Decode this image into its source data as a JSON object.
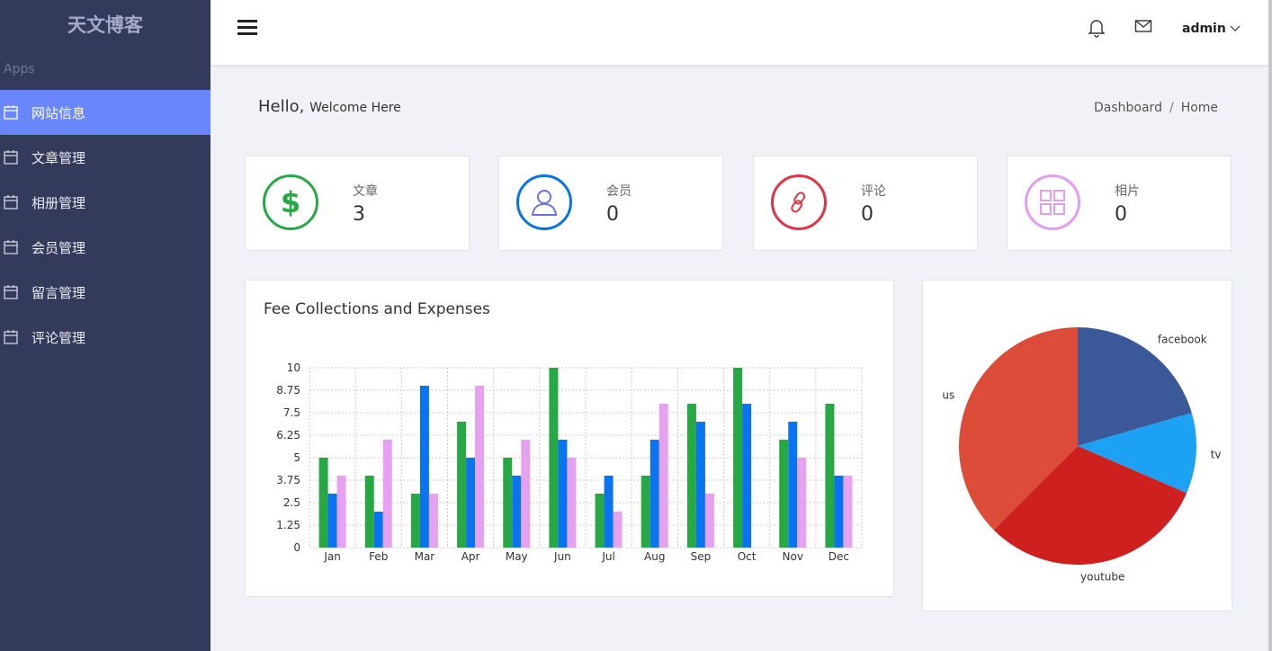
{
  "brand": "天文博客",
  "sidebar": {
    "section_label": "Apps",
    "items": [
      {
        "label": "网站信息",
        "active": true
      },
      {
        "label": "文章管理"
      },
      {
        "label": "相册管理"
      },
      {
        "label": "会员管理"
      },
      {
        "label": "留言管理"
      },
      {
        "label": "评论管理"
      }
    ]
  },
  "header": {
    "user": "admin"
  },
  "page": {
    "hello": "Hello,",
    "welcome": "Welcome Here",
    "breadcrumb": [
      "Dashboard",
      "Home"
    ]
  },
  "stats": [
    {
      "label": "文章",
      "value": "3",
      "icon": "dollar-icon",
      "color": "#28a745"
    },
    {
      "label": "会员",
      "value": "0",
      "icon": "user-icon",
      "color": "#0a74e5"
    },
    {
      "label": "评论",
      "value": "0",
      "icon": "link-icon",
      "color": "#dc3545"
    },
    {
      "label": "相片",
      "value": "0",
      "icon": "grid-icon",
      "color": "#e29df0"
    }
  ],
  "chart_data": [
    {
      "type": "bar",
      "title": "Fee Collections and Expenses",
      "categories": [
        "Jan",
        "Feb",
        "Mar",
        "Apr",
        "May",
        "Jun",
        "Jul",
        "Aug",
        "Sep",
        "Oct",
        "Nov",
        "Dec"
      ],
      "series": [
        {
          "values": [
            5,
            4,
            3,
            7,
            5,
            10,
            3,
            4,
            8,
            10,
            6,
            8
          ],
          "color": "#28a745"
        },
        {
          "values": [
            3,
            2,
            9,
            5,
            4,
            6,
            4,
            6,
            7,
            8,
            7,
            4
          ],
          "color": "#0a74f0"
        },
        {
          "values": [
            4,
            6,
            3,
            9,
            6,
            5,
            2,
            8,
            3,
            0,
            5,
            4
          ],
          "color": "#e6a1f0"
        }
      ],
      "yticks": [
        "10",
        "8.75",
        "7.5",
        "6.25",
        "5",
        "3.75",
        "2.5",
        "1.25",
        "0"
      ],
      "ylim": [
        0,
        10
      ],
      "grid": true
    },
    {
      "type": "pie",
      "slices": [
        {
          "label": "facebook",
          "percent": 20.5,
          "color": "#3b5998"
        },
        {
          "label": "tv",
          "percent": 11,
          "color": "#1da1f2"
        },
        {
          "label": "youtube",
          "percent": 31,
          "color": "#cd201f"
        },
        {
          "label": "us",
          "percent": 37.5,
          "color": "#dd4b39"
        }
      ]
    }
  ]
}
